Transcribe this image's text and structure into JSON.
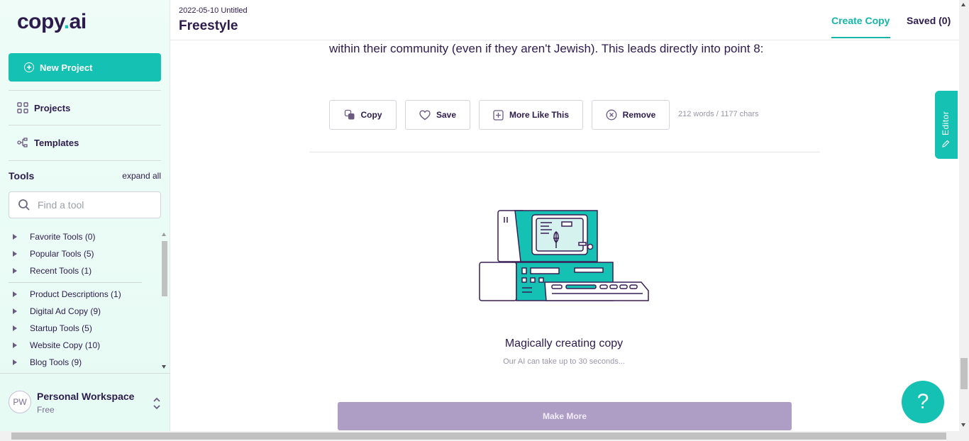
{
  "brand": {
    "name": "copy",
    "dot": ".",
    "suffix": "ai"
  },
  "sidebar": {
    "new_project": "New Project",
    "nav": {
      "projects": "Projects",
      "templates": "Templates"
    },
    "tools_title": "Tools",
    "expand_all": "expand all",
    "search_placeholder": "Find a tool",
    "tool_groups": [
      "Favorite Tools (0)",
      "Popular Tools (5)",
      "Recent Tools (1)",
      "Product Descriptions (1)",
      "Digital Ad Copy (9)",
      "Startup Tools (5)",
      "Website Copy (10)",
      "Blog Tools (9)"
    ],
    "workspace": {
      "initials": "PW",
      "name": "Personal Workspace",
      "plan": "Free"
    }
  },
  "header": {
    "doc_date": "2022-05-10 Untitled",
    "doc_title": "Freestyle",
    "tab_create": "Create Copy",
    "tab_saved": "Saved (0)"
  },
  "main": {
    "result_text": "within their community (even if they aren't Jewish). This leads directly into point 8:",
    "actions": {
      "copy": "Copy",
      "save": "Save",
      "more_like_this": "More Like This",
      "remove": "Remove"
    },
    "count": "212 words / 1177 chars",
    "loading_title": "Magically creating copy",
    "loading_sub": "Our AI can take up to 30 seconds...",
    "make_more": "Make More"
  },
  "editor_tab": "Editor",
  "help": "?",
  "colors": {
    "accent": "#15c1b3",
    "text": "#2d1b4e",
    "disabled_button": "#ae9ec5"
  }
}
